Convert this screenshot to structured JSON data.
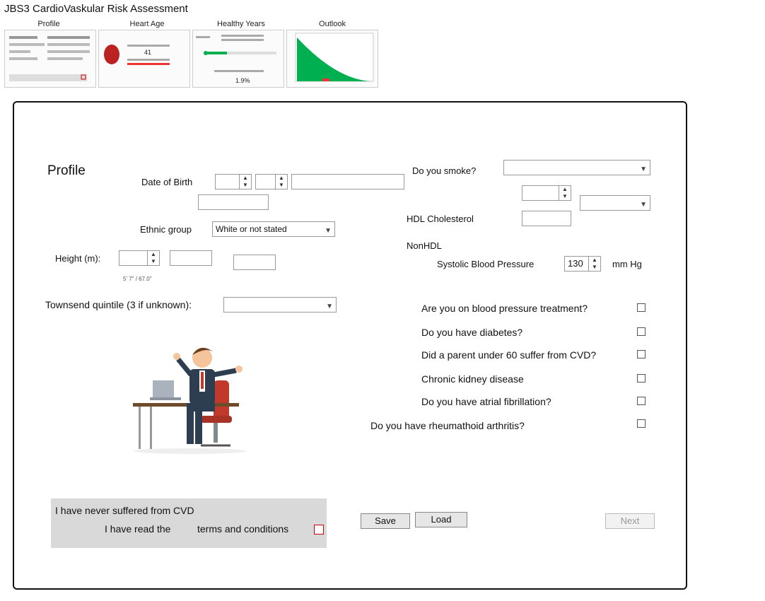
{
  "app": {
    "title": "JBS3 CardioVaskular Risk Assessment"
  },
  "tabs": [
    {
      "label": "Profile"
    },
    {
      "label": "Heart Age"
    },
    {
      "label": "Healthy Years"
    },
    {
      "label": "Outlook"
    }
  ],
  "profile": {
    "heading": "Profile",
    "date_of_birth_label": "Date of Birth",
    "ethnic_group_label": "Ethnic group",
    "ethnic_group_value": "White or not stated",
    "height_label": "Height (m):",
    "height_hint": "5' 7\" / 67.0\"",
    "townsend_label": "Townsend quintile (3 if unknown):",
    "townsend_value": ""
  },
  "clinical": {
    "smoke_label": "Do you smoke?",
    "hdl_label": "HDL Cholesterol",
    "nonhdl_label": "NonHDL",
    "sbp_label": "Systolic Blood Pressure",
    "sbp_value": "130",
    "sbp_unit": "mm Hg"
  },
  "questions": [
    {
      "text": "Are you on blood pressure treatment?"
    },
    {
      "text": "Do you have diabetes?"
    },
    {
      "text": "Did a parent under 60 suffer from CVD?"
    },
    {
      "text": "Chronic kidney disease"
    },
    {
      "text": "Do you have atrial fibrillation?"
    },
    {
      "text": "Do you have rheumathoid arthritis?"
    }
  ],
  "actions": {
    "save": "Save",
    "load": "Load",
    "next": "Next"
  },
  "footer": {
    "line1": "I have never suffered from CVD",
    "line2": "I have read the",
    "terms_link": "terms and conditions"
  },
  "thumbnails": {
    "heart_age_value": "41",
    "healthy_years_pct": "1.9%"
  },
  "colors": {
    "accent_green": "#00b050",
    "frame": "#111111"
  }
}
